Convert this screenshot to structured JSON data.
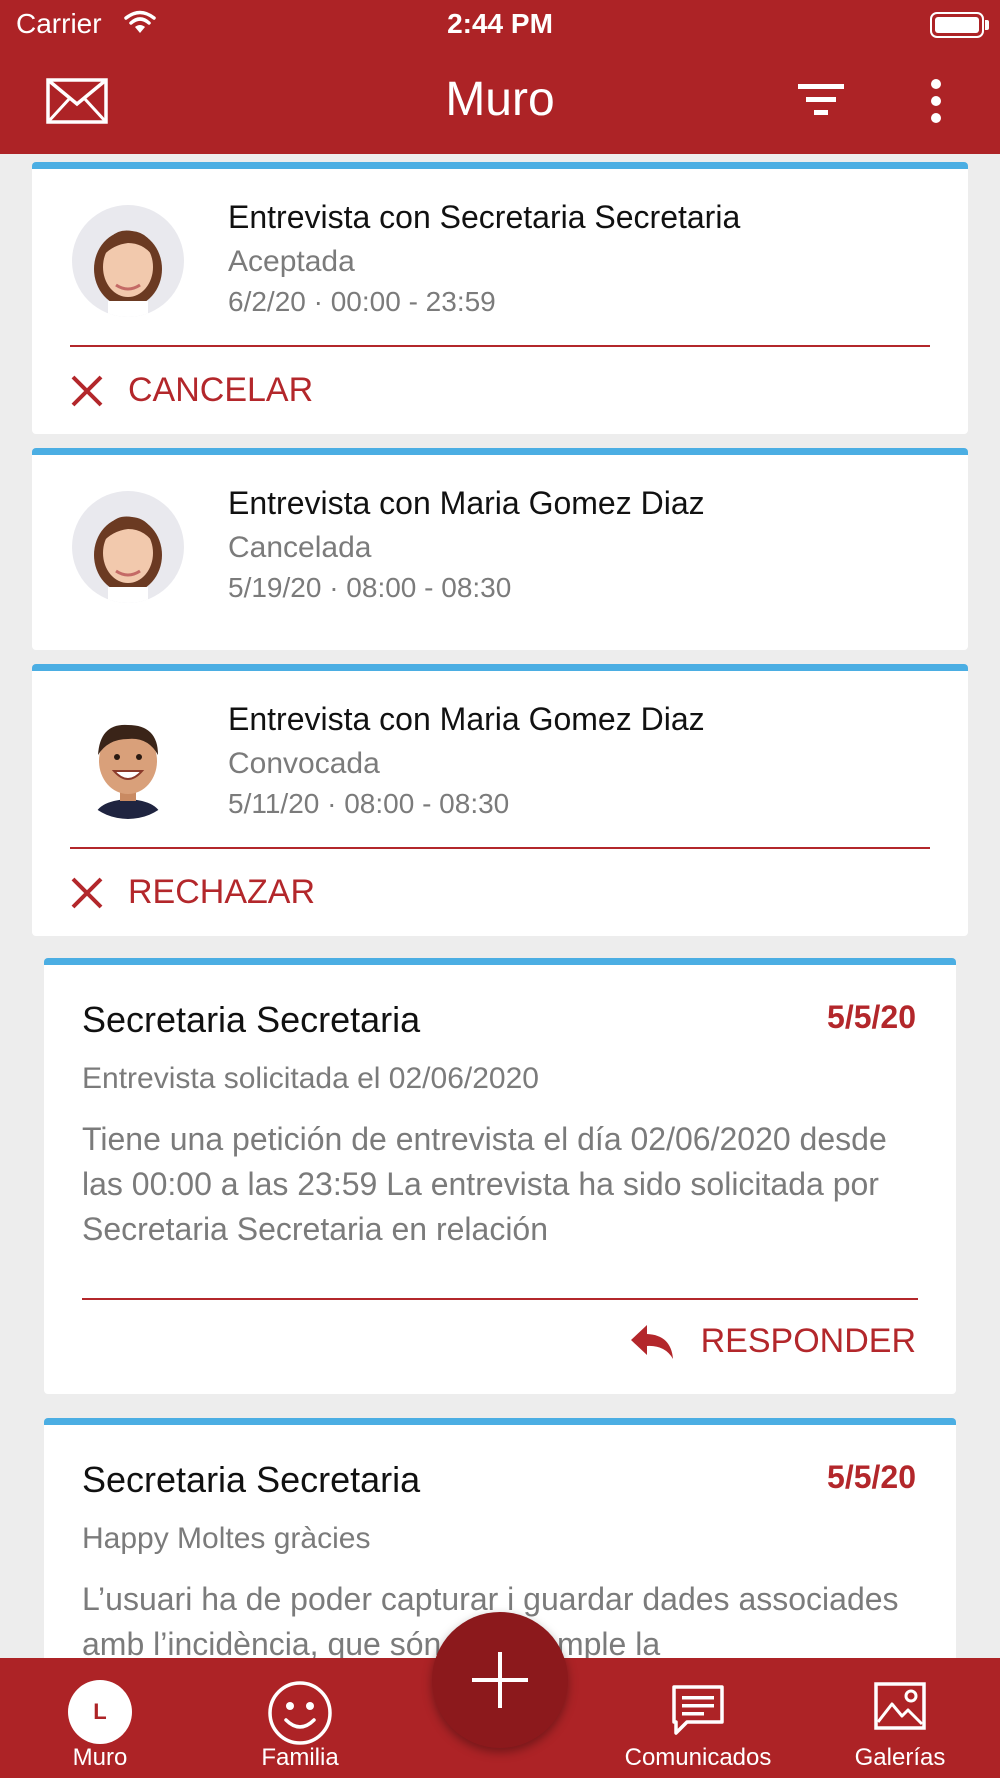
{
  "status_bar": {
    "carrier": "Carrier",
    "time": "2:44 PM"
  },
  "header": {
    "title": "Muro",
    "icons": {
      "left": "mail-icon",
      "filter": "filter-icon",
      "more": "more-vertical-icon"
    }
  },
  "interviews": [
    {
      "title": "Entrevista con Secretaria Secretaria",
      "status": "Aceptada",
      "datetime": "6/2/20 · 00:00 - 23:59",
      "avatar": "woman-avatar",
      "action": "CANCELAR"
    },
    {
      "title": "Entrevista con Maria Gomez Diaz",
      "status": "Cancelada",
      "datetime": "5/19/20 · 08:00 - 08:30",
      "avatar": "woman-avatar"
    },
    {
      "title": "Entrevista con Maria Gomez Diaz",
      "status": "Convocada",
      "datetime": "5/11/20 · 08:00 - 08:30",
      "avatar": "boy-avatar",
      "action": "RECHAZAR"
    }
  ],
  "messages": [
    {
      "sender": "Secretaria Secretaria",
      "date": "5/5/20",
      "subject": "Entrevista solicitada el 02/06/2020",
      "body": "Tiene una petición de entrevista el día 02/06/2020 desde las 00:00 a las 23:59 La entrevista ha sido solicitada por Secretaria Secretaria en relación",
      "action": "RESPONDER"
    },
    {
      "sender": "Secretaria Secretaria",
      "date": "5/5/20",
      "subject": "Happy Moltes gràcies",
      "body": "L’usuari ha de poder capturar i guardar dades associades amb l’incidència, que són per exemple la"
    }
  ],
  "tabs": [
    {
      "label": "Muro",
      "icon": "clock-icon",
      "glyph": "L"
    },
    {
      "label": "Familia",
      "icon": "smiley-icon"
    },
    {
      "label": "Comunicados",
      "icon": "chat-icon"
    },
    {
      "label": "Galerías",
      "icon": "image-icon"
    }
  ],
  "fab_icon": "plus-icon",
  "colors": {
    "primary": "#ad2326",
    "accent_line": "#4baee3",
    "fab": "#8c191c",
    "text_muted": "#7b7b7b"
  }
}
